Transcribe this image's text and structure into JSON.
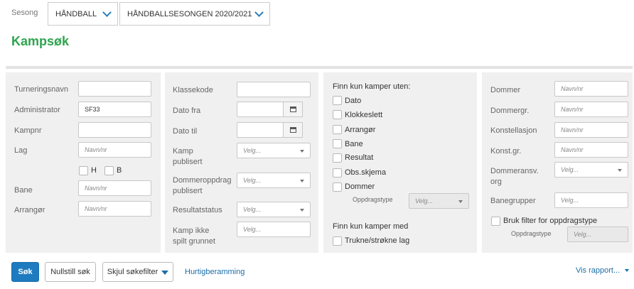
{
  "season": {
    "label": "Sesong",
    "sport": "HÅNDBALL",
    "season": "HÅNDBALLSESONGEN 2020/2021"
  },
  "page_title": "Kampsøk",
  "col1": {
    "turneringsnavn": {
      "label": "Turneringsnavn",
      "value": ""
    },
    "administrator": {
      "label": "Administrator",
      "value": "SF33"
    },
    "kampnr": {
      "label": "Kampnr",
      "value": ""
    },
    "lag": {
      "label": "Lag",
      "placeholder": "Navn/nr"
    },
    "h_label": "H",
    "b_label": "B",
    "bane": {
      "label": "Bane",
      "placeholder": "Navn/nr"
    },
    "arrangor": {
      "label": "Arrangør",
      "placeholder": "Navn/nr"
    }
  },
  "col2": {
    "klassekode": {
      "label": "Klassekode",
      "value": ""
    },
    "dato_fra": {
      "label": "Dato fra",
      "value": ""
    },
    "dato_til": {
      "label": "Dato til",
      "value": ""
    },
    "kamp_publisert": {
      "label_l1": "Kamp",
      "label_l2": "publisert",
      "placeholder": "Velg..."
    },
    "dommeroppdrag": {
      "label_l1": "Dommeroppdrag",
      "label_l2": "publisert",
      "placeholder": "Velg..."
    },
    "resultatstatus": {
      "label": "Resultatstatus",
      "placeholder": "Velg..."
    },
    "kamp_ikke_spilt": {
      "label_l1": "Kamp ikke",
      "label_l2": "spilt grunnet",
      "placeholder": "Velg..."
    }
  },
  "col3": {
    "heading1": "Finn kun kamper uten:",
    "options": [
      "Dato",
      "Klokkeslett",
      "Arrangør",
      "Bane",
      "Resultat",
      "Obs.skjema",
      "Dommer"
    ],
    "oppdragstype": {
      "label": "Oppdragstype",
      "placeholder": "Velg..."
    },
    "heading2": "Finn kun kamper med",
    "option_med": "Trukne/strøkne lag"
  },
  "col4": {
    "dommer": {
      "label": "Dommer",
      "placeholder": "Navn/nr"
    },
    "dommergr": {
      "label": "Dommergr.",
      "placeholder": "Navn/nr"
    },
    "konstellasjon": {
      "label": "Konstellasjon",
      "placeholder": "Navn/nr"
    },
    "konstgr": {
      "label": "Konst.gr.",
      "placeholder": "Navn/nr"
    },
    "dommeransv": {
      "label_l1": "Dommeransv.",
      "label_l2": "org",
      "placeholder": "Velg..."
    },
    "banegrupper": {
      "label": "Banegrupper",
      "placeholder": "Velg..."
    },
    "bruk_filter": "Bruk filter for oppdragstype",
    "oppdragstype": {
      "label": "Oppdragstype",
      "placeholder": "Velg..."
    }
  },
  "buttons": {
    "sok": "Søk",
    "nullstill": "Nullstill søk",
    "skjul": "Skjul søkefilter",
    "hurtig": "Hurtigberamming",
    "vis_rapport": "Vis rapport..."
  },
  "colors": {
    "accent": "#2ea44f",
    "primary": "#1e7bbf",
    "link": "#1a6ea9"
  }
}
